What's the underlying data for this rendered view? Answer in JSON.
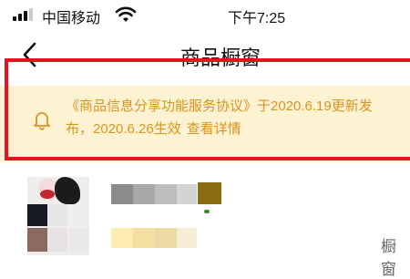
{
  "status_bar": {
    "carrier": "中国移动",
    "time": "下午7:25",
    "signal_icon": "signal-bars-icon",
    "wifi_icon": "wifi-icon"
  },
  "nav": {
    "back_icon": "chevron-left-icon",
    "title": "商品橱窗"
  },
  "notice": {
    "icon": "bell-icon",
    "line1": "《商品信息分享功能服务协议》于2020.6.19更新发",
    "line2": "布，2020.6.26生效",
    "link": "查看详情",
    "highlight_color": "#e3141f",
    "text_color": "#d99320",
    "background": "#fdf3d2"
  },
  "product": {
    "side_label": "橱窗"
  }
}
